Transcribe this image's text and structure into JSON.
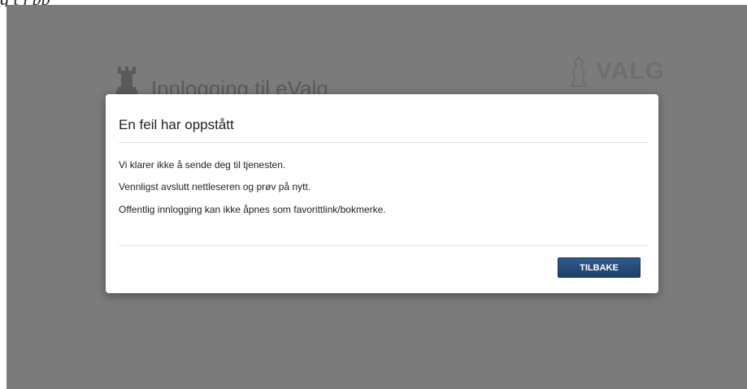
{
  "caption": "g  t   j     pp",
  "background": {
    "title": "Innlogging til eValg",
    "logo_text": "VALG"
  },
  "dialog": {
    "title": "En feil har oppstått",
    "messages": [
      "Vi klarer ikke å sende deg til tjenesten.",
      "Vennligst avslutt nettleseren og prøv på nytt.",
      "Offentlig innlogging kan ikke åpnes som favorittlink/bokmerke."
    ],
    "button_label": "TILBAKE"
  },
  "colors": {
    "overlay": "#7c7b7b",
    "button": "#1d3f66"
  }
}
